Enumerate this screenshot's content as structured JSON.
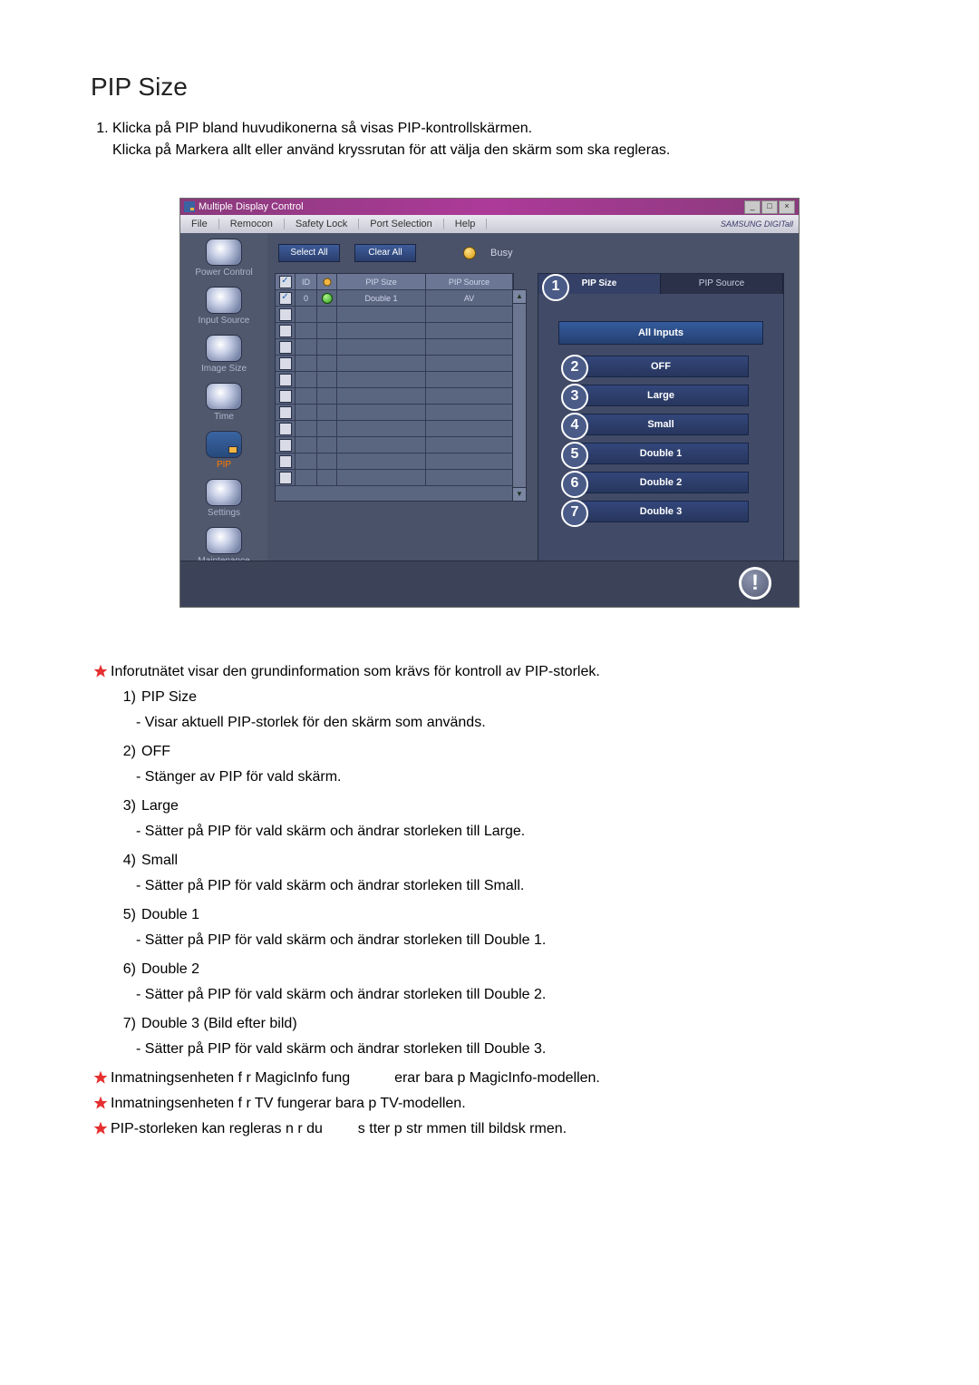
{
  "title": "PIP Size",
  "intro": {
    "item1": "Klicka på PIP bland huvudikonerna så visas PIP-kontrollskärmen.",
    "item1b": "Klicka på Markera allt eller använd kryssrutan för att välja den skärm som ska regleras."
  },
  "app": {
    "window_title": "Multiple Display Control",
    "menu": {
      "file": "File",
      "remocon": "Remocon",
      "safety": "Safety Lock",
      "port": "Port Selection",
      "help": "Help"
    },
    "brand": "SAMSUNG DIGITall",
    "sidebar": {
      "power": "Power Control",
      "input": "Input Source",
      "image": "Image Size",
      "time": "Time",
      "pip": "PIP",
      "settings": "Settings",
      "maint": "Maintenance"
    },
    "toolbar": {
      "select_all": "Select All",
      "clear_all": "Clear All",
      "busy": "Busy"
    },
    "grid": {
      "headers": {
        "id": "ID",
        "size": "PIP Size",
        "source": "PIP Source"
      },
      "row0": {
        "id": "0",
        "size": "Double 1",
        "src": "AV"
      }
    },
    "rpanel": {
      "tab_size": "PIP Size",
      "tab_source": "PIP Source",
      "all_inputs": "All Inputs",
      "opts": {
        "off": "OFF",
        "large": "Large",
        "small": "Small",
        "d1": "Double 1",
        "d2": "Double 2",
        "d3": "Double 3"
      }
    },
    "bubbles": {
      "b1": "1",
      "b2": "2",
      "b3": "3",
      "b4": "4",
      "b5": "5",
      "b6": "6",
      "b7": "7"
    }
  },
  "notes": {
    "info_grid": "Inforutnätet visar den grundinformation som krävs för kontroll av PIP-storlek.",
    "n1_label": "PIP Size",
    "n1_desc": "- Visar aktuell PIP-storlek för den skärm som används.",
    "n2_label": "OFF",
    "n2_desc": "- Stänger av PIP för vald skärm.",
    "n3_label": "Large",
    "n3_desc": "- Sätter på PIP för vald skärm och ändrar storleken till Large.",
    "n4_label": "Small",
    "n4_desc": "- Sätter på PIP för vald skärm och ändrar storleken till Small.",
    "n5_label": "Double 1",
    "n5_desc": "- Sätter på PIP för vald skärm och ändrar storleken till Double 1.",
    "n6_label": "Double 2",
    "n6_desc": "- Sätter på PIP för vald skärm och ändrar storleken till Double 2.",
    "n7_label": "Double 3 (Bild efter bild)",
    "n7_desc": "- Sätter på PIP för vald skärm och ändrar storleken till Double 3.",
    "star1a": "Inmatningsenheten f r MagicInfo fung",
    "star1b": "erar bara p  MagicInfo-modellen.",
    "star2": "Inmatningsenheten f r TV fungerar bara p  TV-modellen.",
    "star3a": "PIP-storleken kan regleras n r du ",
    "star3b": "s tter p  str mmen till bildsk rmen."
  },
  "numbers": {
    "n1": "1)",
    "n2": "2)",
    "n3": "3)",
    "n4": "4)",
    "n5": "5)",
    "n6": "6)",
    "n7": "7)"
  }
}
